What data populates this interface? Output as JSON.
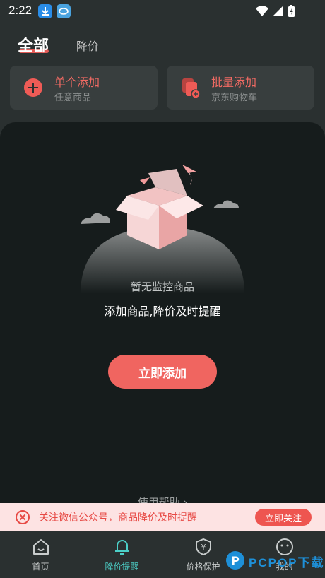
{
  "status_bar": {
    "time": "2:22",
    "icons": [
      "download-icon",
      "app-notification-icon",
      "wifi-icon",
      "signal-icon",
      "battery-icon"
    ]
  },
  "tabs": [
    {
      "label": "全部",
      "active": true
    },
    {
      "label": "降价",
      "active": false
    }
  ],
  "cards": {
    "single": {
      "title": "单个添加",
      "subtitle": "任意商品"
    },
    "batch": {
      "title": "批量添加",
      "subtitle": "京东购物车"
    }
  },
  "empty_state": {
    "message": "暂无监控商品",
    "hint": "添加商品,降价及时提醒",
    "button": "立即添加",
    "help_link": "使用帮助 ›"
  },
  "banner": {
    "text": "关注微信公众号，商品降价及时提醒",
    "button": "立即关注"
  },
  "bottom_nav": [
    {
      "label": "首页",
      "icon": "home-icon",
      "active": false
    },
    {
      "label": "降价提醒",
      "icon": "bell-icon",
      "active": true
    },
    {
      "label": "价格保护",
      "icon": "shield-yen-icon",
      "active": false
    },
    {
      "label": "我的",
      "icon": "smiley-icon",
      "active": false
    }
  ],
  "colors": {
    "accent": "#f06560",
    "active_nav": "#4cd0c8",
    "background": "#2a3030",
    "panel": "#161c1c"
  },
  "watermark": "PCPOP下载"
}
